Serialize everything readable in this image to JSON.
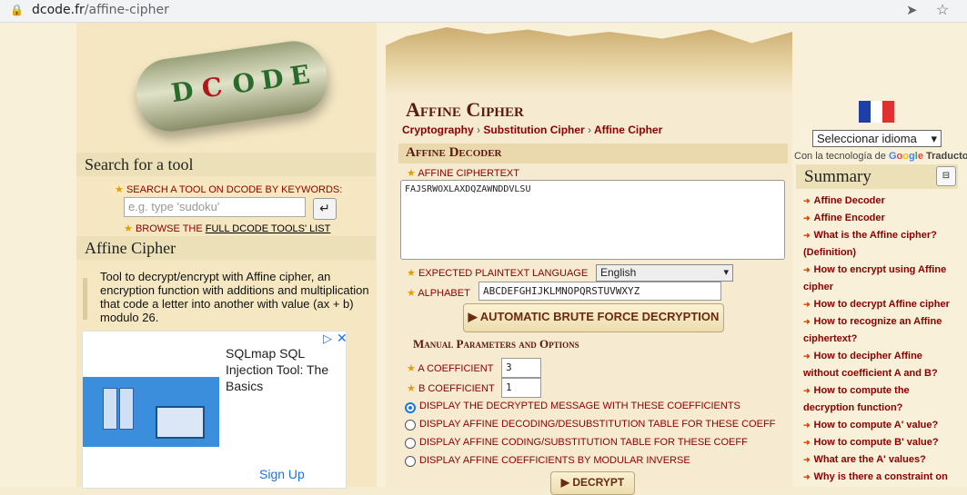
{
  "browser": {
    "url_domain": "dcode.fr",
    "url_path": "/affine-cipher"
  },
  "logo": {
    "letters": [
      "D",
      "C",
      "O",
      "D",
      "E"
    ]
  },
  "sidebar": {
    "search_title": "Search for a tool",
    "search_label": "SEARCH A TOOL ON DCODE BY KEYWORDS:",
    "search_placeholder": "e.g. type 'sudoku'",
    "browse_prefix": "BROWSE THE",
    "browse_link": "FULL DCODE TOOLS' LIST",
    "tool_title": "Affine Cipher",
    "tool_description": "Tool to decrypt/encrypt with Affine cipher, an encryption function with additions and multiplication that code a letter into another with value (ax + b) modulo 26."
  },
  "ad": {
    "title": "SQLmap SQL Injection Tool: The Basics",
    "cta": "Sign Up",
    "adchoices": "▷",
    "close": "✕"
  },
  "main": {
    "title": "Affine Cipher",
    "breadcrumbs": [
      "Cryptography",
      "Substitution Cipher",
      "Affine Cipher"
    ],
    "breadcrumb_sep": "›",
    "decoder_title": "Affine Decoder",
    "ciphertext_label": "AFFINE CIPHERTEXT",
    "ciphertext_value": "FAJSRWOXLAXDQZAWNDDVLSU",
    "plaintext_lang_label": "EXPECTED PLAINTEXT LANGUAGE",
    "plaintext_lang_value": "English",
    "alphabet_label": "ALPHABET",
    "alphabet_value": "ABCDEFGHIJKLMNOPQRSTUVWXYZ",
    "brute_force_button": "▶ AUTOMATIC BRUTE FORCE DECRYPTION",
    "manual_title": "Manual Parameters and Options",
    "a_label": "A COEFFICIENT",
    "a_value": "3",
    "b_label": "B COEFFICIENT",
    "b_value": "1",
    "options": [
      {
        "label": "DISPLAY THE DECRYPTED MESSAGE WITH THESE COEFFICIENTS",
        "selected": true
      },
      {
        "label": "DISPLAY AFFINE DECODING/DESUBSTITUTION TABLE FOR THESE COEFF",
        "selected": false
      },
      {
        "label": "DISPLAY AFFINE CODING/SUBSTITUTION TABLE FOR THESE COEFF",
        "selected": false
      },
      {
        "label": "DISPLAY AFFINE COEFFICIENTS BY MODULAR INVERSE",
        "selected": false
      }
    ],
    "decrypt_button": "▶ DECRYPT"
  },
  "right": {
    "language_select": "Seleccionar idioma",
    "powered_prefix": "Con la tecnología de",
    "powered_brand": "Google",
    "powered_suffix": "Traductor",
    "summary_title": "Summary",
    "summary_toggle": "⊟",
    "summary_items": [
      "Affine Decoder",
      "Affine Encoder",
      "What is the Affine cipher? (Definition)",
      "How to encrypt using Affine cipher",
      "How to decrypt Affine cipher",
      "How to recognize an Affine ciphertext?",
      "How to decipher Affine without coefficient A and B?",
      "How to compute the decryption function?",
      "How to compute A' value?",
      "How to compute B' value?",
      "What are the A' values?",
      "Why is there a constraint on"
    ]
  },
  "colors": {
    "accent_text": "#8b0000",
    "title_brown": "#5a1a10",
    "page_bg": "#f8f0d8",
    "link_blue": "#1a73e8"
  }
}
